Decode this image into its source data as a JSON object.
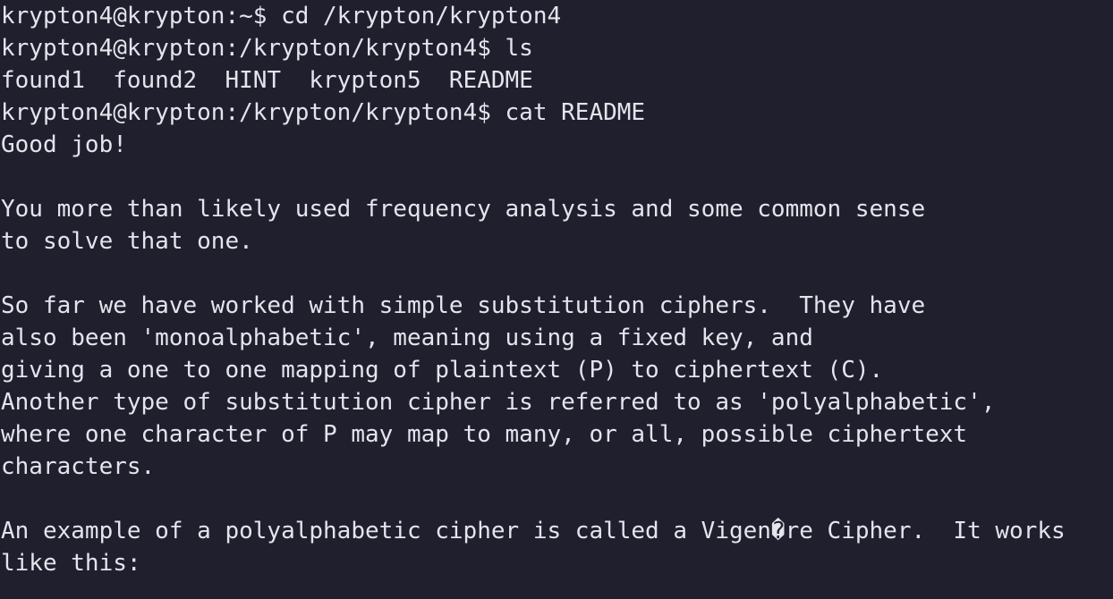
{
  "terminal": {
    "lines": [
      "krypton4@krypton:~$ cd /krypton/krypton4",
      "krypton4@krypton:/krypton/krypton4$ ls",
      "found1  found2  HINT  krypton5  README",
      "krypton4@krypton:/krypton/krypton4$ cat README",
      "Good job!",
      "",
      "You more than likely used frequency analysis and some common sense",
      "to solve that one.",
      "",
      "So far we have worked with simple substitution ciphers.  They have",
      "also been 'monoalphabetic', meaning using a fixed key, and",
      "giving a one to one mapping of plaintext (P) to ciphertext (C).",
      "Another type of substitution cipher is referred to as 'polyalphabetic',",
      "where one character of P may map to many, or all, possible ciphertext",
      "characters.",
      "",
      "An example of a polyalphabetic cipher is called a Vigen�re Cipher.  It works",
      "like this:"
    ]
  }
}
